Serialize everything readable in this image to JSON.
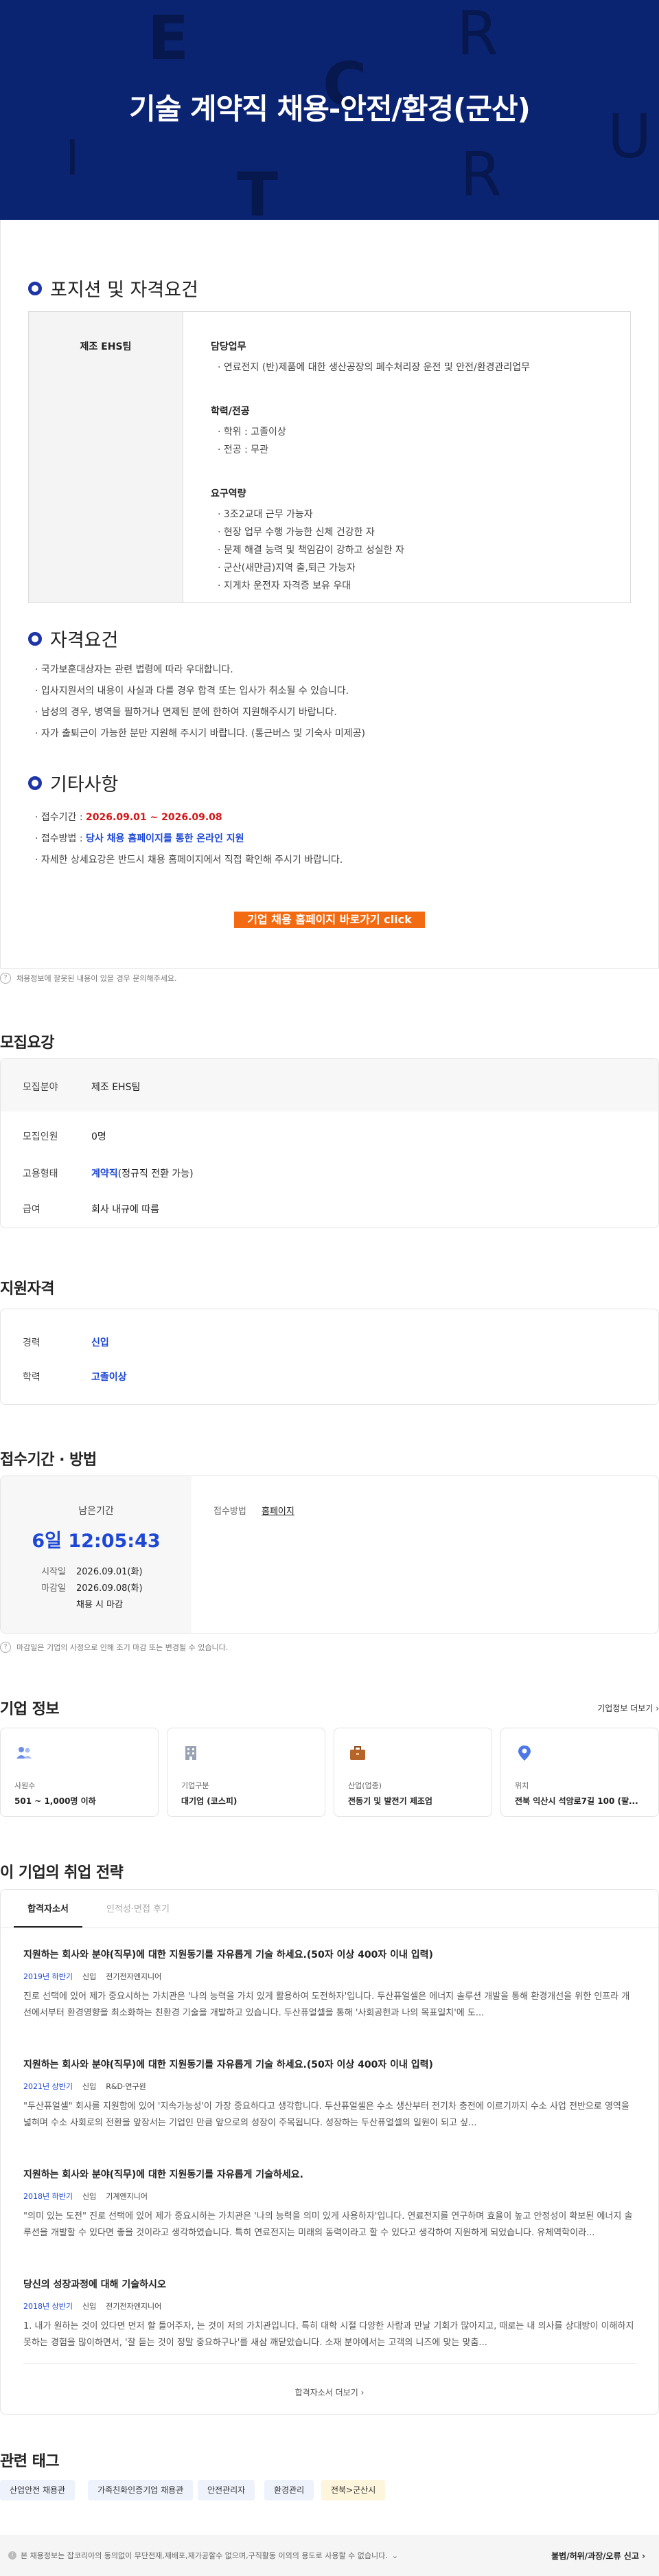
{
  "banner": {
    "title": "기술 계약직 채용-안전/환경(군산)",
    "deco_letters": [
      "E",
      "C",
      "R",
      "U",
      "I",
      "T",
      "R"
    ]
  },
  "position_section": {
    "heading": "포지션 및 자격요건",
    "team": "제조 EHS팀",
    "blocks": [
      {
        "title": "담당업무",
        "lines": [
          "연료전지 (반)제품에 대한 생산공장의 폐수처리장 운전 및 안전/환경관리업무"
        ]
      },
      {
        "title": "학력/전공",
        "lines": [
          "학위 : 고졸이상",
          "전공 : 무관"
        ]
      },
      {
        "title": "요구역량",
        "lines": [
          "3조2교대 근무 가능자",
          "현장 업무 수행 가능한 신체 건강한 자",
          "문제 해결 능력 및 책임감이 강하고 성실한 자",
          "군산(새만금)지역 출,퇴근 가능자",
          "지게차 운전자 자격증 보유 우대"
        ]
      }
    ]
  },
  "qualification_section": {
    "heading": "자격요건",
    "lines": [
      "국가보훈대상자는 관련 법령에 따라 우대합니다.",
      "입사지원서의 내용이 사실과 다를 경우 합격 또는 입사가 취소될 수 있습니다.",
      "남성의 경우, 병역을 필하거나 면제된 분에 한하여 지원해주시기 바랍니다.",
      "자가 출퇴근이 가능한 분만 지원해 주시기 바랍니다. (통근버스 및 기숙사 미제공)"
    ]
  },
  "other_section": {
    "heading": "기타사항",
    "period_label": "접수기간 : ",
    "period_value": "2026.09.01 ~ 2026.09.08",
    "method_label": "접수방법 : ",
    "method_value": "당사 채용 홈페이지를 통한 온라인 지원",
    "extra": "자세한 상세요강은 반드시 채용 홈페이지에서 직접 확인해 주시기 바랍니다."
  },
  "cta_label": "기업 채용 홈페이지 바로가기 click",
  "report_notice": "채용정보에 잘못된 내용이 있을 경우 문의해주세요.",
  "recruit_summary": {
    "heading": "모집요강",
    "rows": [
      {
        "k": "모집분야",
        "v": "제조 EHS팀"
      },
      {
        "k": "모집인원",
        "v": "0명"
      },
      {
        "k": "고용형태",
        "v_link": "계약직",
        "v": "(정규직 전환 가능)"
      },
      {
        "k": "급여",
        "v": "회사 내규에 따름"
      }
    ]
  },
  "eligibility": {
    "heading": "지원자격",
    "rows": [
      {
        "k": "경력",
        "v": "신입"
      },
      {
        "k": "학력",
        "v": "고졸이상"
      }
    ]
  },
  "period": {
    "heading": "접수기간 · 방법",
    "remaining_label": "남은기간",
    "remaining_value": "6일 12:05:43",
    "start_label": "시작일",
    "start_value": "2026.09.01(화)",
    "end_label": "마감일",
    "end_value": "2026.09.08(화)",
    "end_note": "채용 시 마감",
    "method_label": "접수방법",
    "method_value": "홈페이지",
    "notice": "마감일은 기업의 사정으로 인해 조기 마감 또는 변경될 수 있습니다."
  },
  "company": {
    "heading": "기업 정보",
    "more": "기업정보 더보기",
    "cards": [
      {
        "label": "사원수",
        "value": "501 ~ 1,000명 이하",
        "icon": "people-icon"
      },
      {
        "label": "기업구분",
        "value": "대기업 (코스피)",
        "icon": "building-icon"
      },
      {
        "label": "산업(업종)",
        "value": "전동기 및 발전기 제조업",
        "icon": "briefcase-icon"
      },
      {
        "label": "위치",
        "value": "전북 익산시 석암로7길 100 (팔...",
        "icon": "location-pin-icon"
      }
    ]
  },
  "strategy": {
    "heading": "이 기업의 취업 전략",
    "tabs": [
      "합격자소서",
      "인적성·면접 후기"
    ],
    "essays": [
      {
        "q": "지원하는 회사와 분야(직무)에 대한 지원동기를 자유롭게 기술 하세요.(50자 이상 400자 이내 입력)",
        "year": "2019년 하반기",
        "type": "신입",
        "job": "전기전자엔지니어",
        "a": "진로 선택에 있어 제가 중요시하는 가치관은 '나의 능력을 가치 있게 활용하여 도전하자'입니다. 두산퓨얼셀은 에너지 솔루션 개발을 통해 환경개선을 위한 인프라 개선에서부터 환경영향을 최소화하는 친환경 기술을 개발하고 있습니다. 두산퓨얼셀을 통해 '사회공헌과 나의 목표일치'에 도..."
      },
      {
        "q": "지원하는 회사와 분야(직무)에 대한 지원동기를 자유롭게 기술 하세요.(50자 이상 400자 이내 입력)",
        "year": "2021년 상반기",
        "type": "신입",
        "job": "R&D·연구원",
        "a": "\"두산퓨얼셀\" 회사를 지원함에 있어 '지속가능성'이 가장 중요하다고 생각합니다. 두산퓨얼셀은 수소 생산부터 전기차 충전에 이르기까지 수소 사업 전반으로 영역을 넓혀며 수소 사회로의 전환을 앞장서는 기업인 만큼 앞으로의 성장이 주목됩니다. 성장하는 두산퓨얼셀의 일원이 되고 싶..."
      },
      {
        "q": "지원하는 회사와 분야(직무)에 대한 지원동기를 자유롭게 기술하세요.",
        "year": "2018년 하반기",
        "type": "신입",
        "job": "기계엔지니어",
        "a": "\"의미 있는 도전\" 진로 선택에 있어 제가 중요시하는 가치관은 '나의 능력을 의미 있게 사용하자'입니다. 연료전지를 연구하며 효율이 높고 안정성이 확보된 에너지 솔루션을 개발할 수 있다면 좋을 것이라고 생각하였습니다. 특히 연료전지는 미래의 동력이라고 할 수 있다고 생각하여 지원하게 되었습니다. 유체역학이라..."
      },
      {
        "q": "당신의 성장과정에 대해 기술하시오",
        "year": "2018년 상반기",
        "type": "신입",
        "job": "전기전자엔지니어",
        "a": "1. 내가 원하는 것이 있다면 먼저 할 들어주자, 는 것이 저의 가치관입니다. 특히 대학 시절 다양한 사람과 만날 기회가 많아지고, 때로는 내 의사를 상대방이 이해하지 못하는 경험을 많이하면서, '잘 듣는 것이 정말 중요하구나'를 새삼 깨닫았습니다. 소재 분야에서는 고객의 니즈에 맞는 맞춤..."
      }
    ],
    "more": "합격자소서 더보기"
  },
  "tags": {
    "heading": "관련 태그",
    "items": [
      "산업안전 채용관",
      "가족친화인증기업 채용관",
      "안전관리자",
      "환경관리",
      "전북>군산시"
    ]
  },
  "footer": {
    "notice": "본 채용정보는 잡코리아의 동의없이 무단전재,재배포,재가공할수 없으며,구직활동 이외의 용도로 사용할 수 없습니다.",
    "report": "불법/허위/과장/오류 신고"
  },
  "colors": {
    "banner_bg": "#0b2472",
    "accent_blue": "#1d47d4",
    "cta_orange": "#f26a12",
    "deadline_red": "#d31515"
  }
}
